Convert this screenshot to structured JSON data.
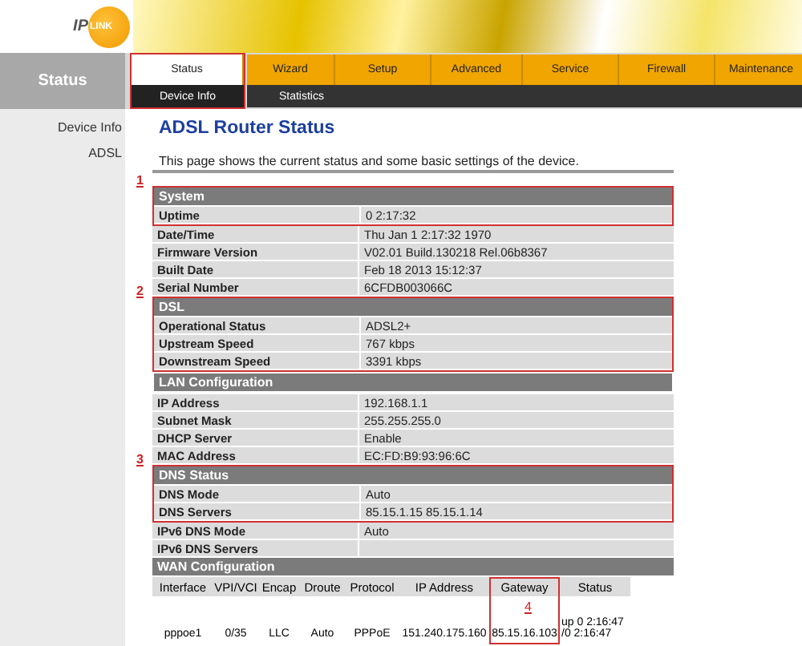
{
  "logo": {
    "prefix": "IP",
    "badge": "LINK"
  },
  "sidebar": {
    "title": "Status",
    "items": [
      {
        "label": "Device Info"
      },
      {
        "label": "ADSL"
      }
    ]
  },
  "nav": {
    "tabs": [
      {
        "label": "Status",
        "selected": true,
        "annotated": true
      },
      {
        "label": "Wizard",
        "selected": false,
        "annotated": false
      },
      {
        "label": "Setup",
        "selected": false,
        "annotated": false
      },
      {
        "label": "Advanced",
        "selected": false,
        "annotated": false
      },
      {
        "label": "Service",
        "selected": false,
        "annotated": false
      },
      {
        "label": "Firewall",
        "selected": false,
        "annotated": false
      },
      {
        "label": "Maintenance",
        "selected": false,
        "annotated": false
      }
    ],
    "subtabs": [
      {
        "label": "Device Info",
        "selected": true
      },
      {
        "label": "Statistics",
        "selected": false
      }
    ]
  },
  "page": {
    "title": "ADSL Router Status",
    "description": "This page shows the current status and some basic settings of the device."
  },
  "sections": [
    {
      "title": "System",
      "marker": "1",
      "rows": [
        {
          "label": "Uptime",
          "value": "0 2:17:32",
          "annotated": true
        },
        {
          "label": "Date/Time",
          "value": "Thu Jan 1 2:17:32 1970",
          "annotated": false
        },
        {
          "label": "Firmware Version",
          "value": "V02.01 Build.130218 Rel.06b8367",
          "annotated": false
        },
        {
          "label": "Built Date",
          "value": "Feb 18 2013 15:12:37",
          "annotated": false
        },
        {
          "label": "Serial Number",
          "value": "6CFDB003066C",
          "annotated": false
        }
      ]
    },
    {
      "title": "DSL",
      "marker": "2",
      "rows": [
        {
          "label": "Operational Status",
          "value": "ADSL2+",
          "annotated": true
        },
        {
          "label": "Upstream Speed",
          "value": "767 kbps",
          "annotated": true
        },
        {
          "label": "Downstream Speed",
          "value": "3391 kbps",
          "annotated": true
        }
      ]
    },
    {
      "title": "LAN Configuration",
      "rows": [
        {
          "label": "IP Address",
          "value": "192.168.1.1",
          "annotated": false
        },
        {
          "label": "Subnet Mask",
          "value": "255.255.255.0",
          "annotated": false
        },
        {
          "label": "DHCP Server",
          "value": "Enable",
          "annotated": false
        },
        {
          "label": "MAC Address",
          "value": "EC:FD:B9:93:96:6C",
          "annotated": false
        }
      ]
    },
    {
      "title": "DNS Status",
      "marker": "3",
      "rows": [
        {
          "label": "DNS Mode",
          "value": "Auto",
          "annotated": true
        },
        {
          "label": "DNS Servers",
          "value": "85.15.1.15 85.15.1.14",
          "annotated": true
        },
        {
          "label": "IPv6 DNS Mode",
          "value": "Auto",
          "annotated": false
        },
        {
          "label": "IPv6 DNS Servers",
          "annotated": false
        }
      ]
    }
  ],
  "wan": {
    "title": "WAN Configuration",
    "columns": [
      {
        "label": "Interface",
        "annotated": false
      },
      {
        "label": "VPI/VCI",
        "annotated": false
      },
      {
        "label": "Encap",
        "annotated": false
      },
      {
        "label": "Droute",
        "annotated": false
      },
      {
        "label": "Protocol",
        "annotated": false
      },
      {
        "label": "IP Address",
        "annotated": false
      },
      {
        "label": "Gateway",
        "annotated": true,
        "marker": "4"
      },
      {
        "label": "Status",
        "annotated": false
      }
    ],
    "rows": [
      [
        "pppoe1",
        "0/35",
        "LLC",
        "Auto",
        "PPPoE",
        "151.240.175.160",
        "85.15.16.103",
        "up 0 2:16:47 /0 2:16:47"
      ]
    ]
  }
}
